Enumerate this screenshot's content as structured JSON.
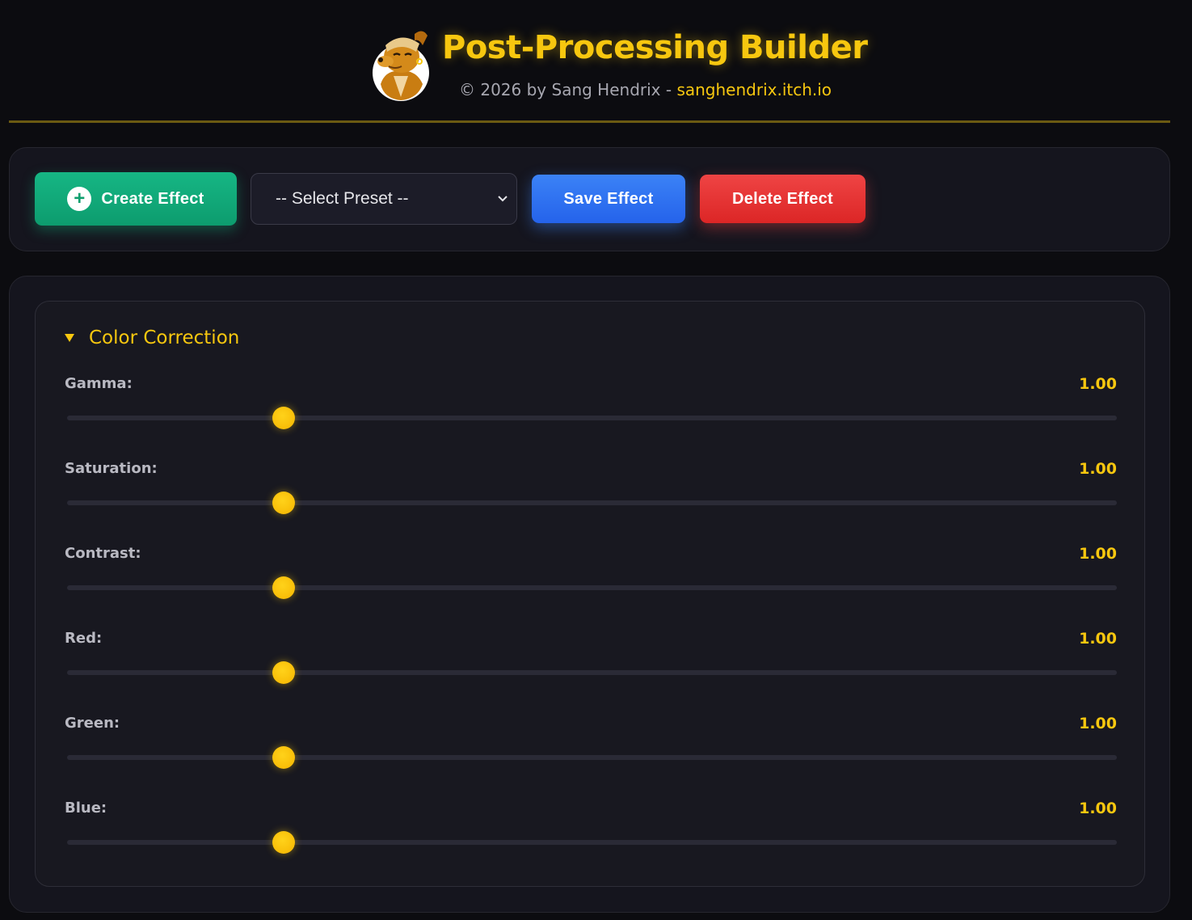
{
  "header": {
    "title": "Post-Processing Builder",
    "copyright": "© 2026 by Sang Hendrix - ",
    "link": "sanghendrix.itch.io",
    "avatar_icon": "dog-mascot-icon",
    "accent_color": "#f7c70f"
  },
  "toolbar": {
    "create_label": "Create Effect",
    "preset_selected": "-- Select Preset --",
    "save_label": "Save Effect",
    "delete_label": "Delete Effect",
    "create_color": "#10b981",
    "save_color": "#3b82f6",
    "delete_color": "#ef4444"
  },
  "section": {
    "title": "Color Correction",
    "expanded": true,
    "sliders": [
      {
        "label": "Gamma:",
        "value": "1.00",
        "fraction": 0.206
      },
      {
        "label": "Saturation:",
        "value": "1.00",
        "fraction": 0.206
      },
      {
        "label": "Contrast:",
        "value": "1.00",
        "fraction": 0.206
      },
      {
        "label": "Red:",
        "value": "1.00",
        "fraction": 0.206
      },
      {
        "label": "Green:",
        "value": "1.00",
        "fraction": 0.206
      },
      {
        "label": "Blue:",
        "value": "1.00",
        "fraction": 0.206
      }
    ]
  }
}
